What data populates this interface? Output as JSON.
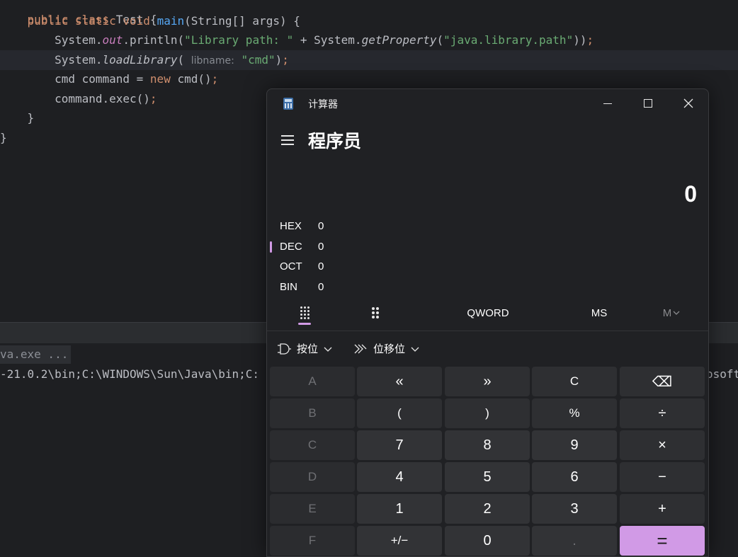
{
  "editor": {
    "lines": [
      {
        "kw1": "public",
        "rest": " class ",
        "name": "Test",
        " tail": " {"
      },
      {
        "indent": "    ",
        "kw": "public static void ",
        "fn": "main",
        "args": "(String[] args) {"
      },
      {
        "indent": "        ",
        "obj": "System.",
        "field": "out",
        "call": ".println(",
        "str1": "\"Library path: \"",
        "plus": " + System.",
        "meth": "getProperty",
        "open": "(",
        "str2": "\"java.library.path\"",
        "close": "));"
      },
      {
        "indent": "        ",
        "obj": "System.",
        "meth": "loadLibrary",
        "open": "( ",
        "hint": "libname:",
        "str": "\"cmd\"",
        "close": ");"
      },
      {
        "indent": "        ",
        "text": "cmd command = ",
        "kw": "new",
        "rest": " cmd();"
      },
      {
        "indent": "        ",
        "text": "command.exec();"
      },
      {
        "indent": "    ",
        "text": "}"
      },
      {
        "indent": "",
        "text": "}"
      }
    ],
    "line0": "public class Test {"
  },
  "console": {
    "line1": "va.exe ...",
    "line2_left": "-21.0.2\\bin;C:\\WINDOWS\\Sun\\Java\\bin;C:",
    "line2_right": "osoft"
  },
  "calculator": {
    "window_title": "计算器",
    "mode": "程序员",
    "display_value": "0",
    "radix": [
      {
        "label": "HEX",
        "value": "0",
        "selected": false
      },
      {
        "label": "DEC",
        "value": "0",
        "selected": true
      },
      {
        "label": "OCT",
        "value": "0",
        "selected": false
      },
      {
        "label": "BIN",
        "value": "0",
        "selected": false
      }
    ],
    "toolbar": {
      "word_size": "QWORD",
      "ms": "MS",
      "m_dropdown": "M"
    },
    "bitwise_label": "按位",
    "bitshift_label": "位移位",
    "keys": [
      [
        "A",
        "«",
        "»",
        "C",
        "⌫"
      ],
      [
        "B",
        "(",
        ")",
        "%",
        "÷"
      ],
      [
        "C",
        "7",
        "8",
        "9",
        "×"
      ],
      [
        "D",
        "4",
        "5",
        "6",
        "−"
      ],
      [
        "E",
        "1",
        "2",
        "3",
        "+"
      ],
      [
        "F",
        "+/−",
        "0",
        ".",
        "="
      ]
    ],
    "accent_color": "#d19ae6"
  }
}
